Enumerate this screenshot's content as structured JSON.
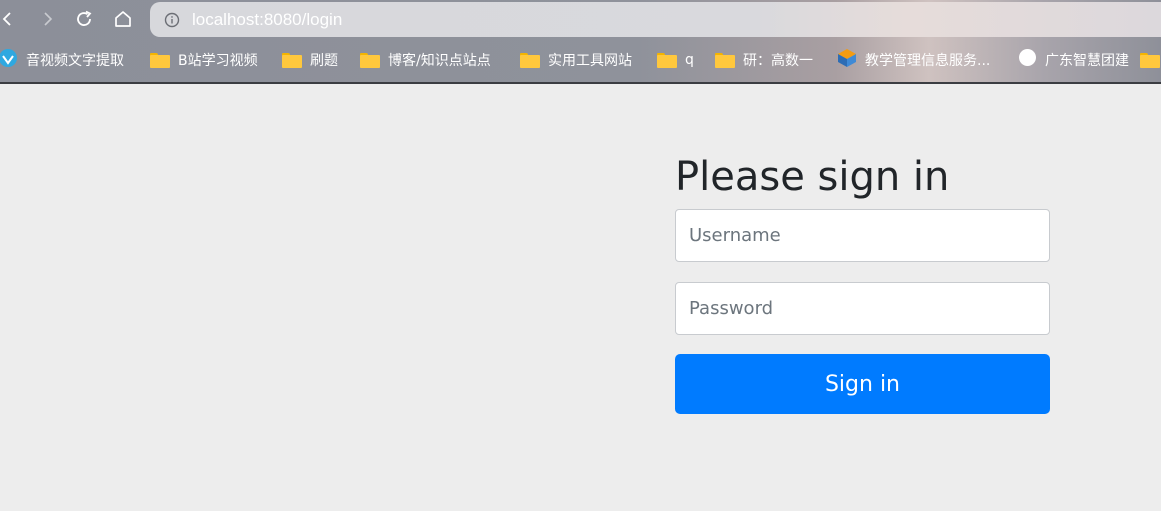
{
  "browser": {
    "address_bar": {
      "url": "localhost:8080/login"
    },
    "bookmarks": [
      {
        "label": "音视频文字提取",
        "icon": "app-icon"
      },
      {
        "label": "B站学习视频",
        "icon": "folder-icon"
      },
      {
        "label": "刷题",
        "icon": "folder-icon"
      },
      {
        "label": "博客/知识点站点",
        "icon": "folder-icon"
      },
      {
        "label": "实用工具网站",
        "icon": "folder-icon"
      },
      {
        "label": "q",
        "icon": "folder-icon"
      },
      {
        "label": "研：高数一",
        "icon": "folder-icon"
      },
      {
        "label": "教学管理信息服务...",
        "icon": "app-icon"
      },
      {
        "label": "广东智慧团建",
        "icon": "circle-icon"
      }
    ]
  },
  "login": {
    "heading": "Please sign in",
    "username_placeholder": "Username",
    "password_placeholder": "Password",
    "submit_label": "Sign in"
  },
  "colors": {
    "primary": "#007bff",
    "page_background": "#ededed",
    "heading_text": "#212529"
  }
}
